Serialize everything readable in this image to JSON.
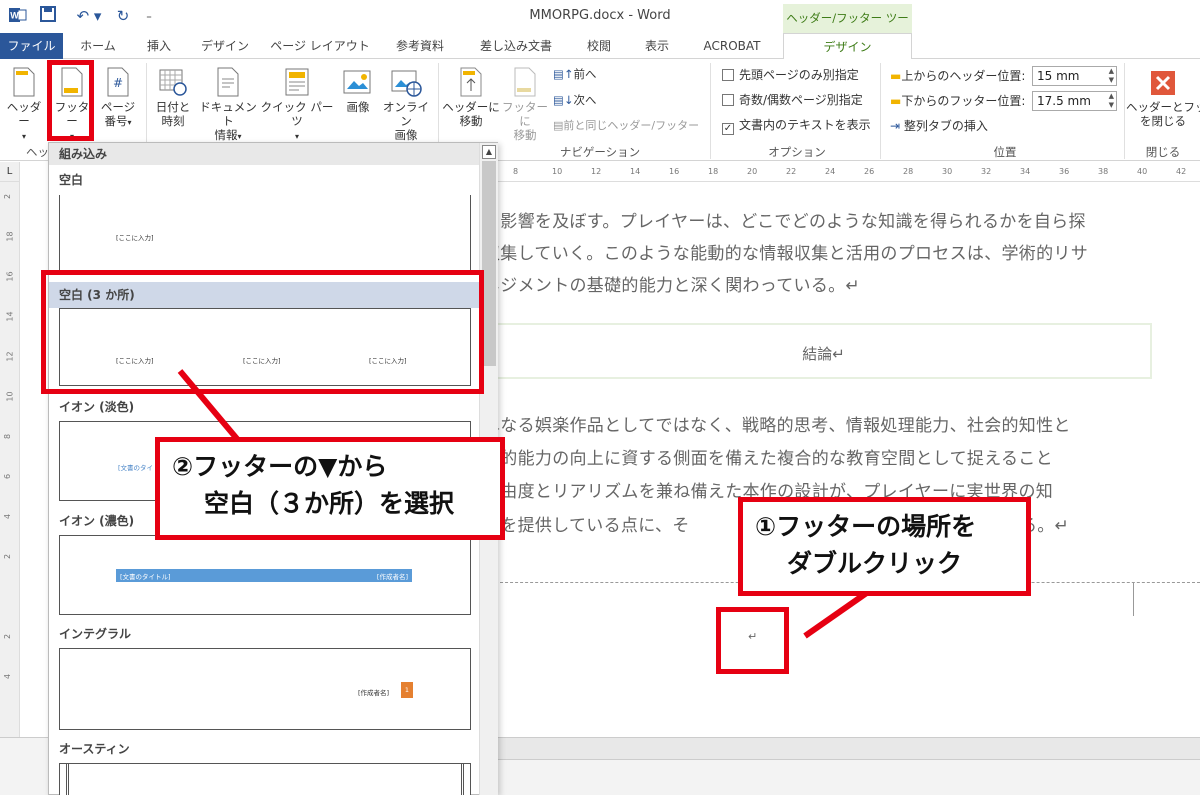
{
  "window": {
    "title": "MMORPG.docx - Word",
    "context_tab": "ヘッダー/フッター ツール"
  },
  "tabs": [
    "ファイル",
    "ホーム",
    "挿入",
    "デザイン",
    "ページ レイアウト",
    "参考資料",
    "差し込み文書",
    "校閲",
    "表示",
    "ACROBAT",
    "デザイン"
  ],
  "ribbon": {
    "header_btn": "ヘッダー",
    "footer_btn": "フッター",
    "pagenum_btn1": "ページ",
    "pagenum_btn2": "番号",
    "date_btn1": "日付と",
    "date_btn2": "時刻",
    "docinfo_btn1": "ドキュメント",
    "docinfo_btn2": "情報",
    "quickparts_btn": "クイック パーツ",
    "picture_btn": "画像",
    "online_btn1": "オンライン",
    "online_btn2": "画像",
    "goto_header1": "ヘッダーに",
    "goto_header2": "移動",
    "goto_footer1": "フッターに",
    "goto_footer2": "移動",
    "prev": "前へ",
    "next": "次へ",
    "link_prev": "前と同じヘッダー/フッター",
    "nav_group": "ナビゲーション",
    "opt_first": "先頭ページのみ別指定",
    "opt_oddeven": "奇数/偶数ページ別指定",
    "opt_showtext": "文書内のテキストを表示",
    "options_group": "オプション",
    "header_pos_label": "上からのヘッダー位置:",
    "header_pos_value": "15 mm",
    "footer_pos_label": "下からのフッター位置:",
    "footer_pos_value": "17.5 mm",
    "align_tab": "整列タブの挿入",
    "position_group": "位置",
    "close_btn1": "ヘッダーとフッ",
    "close_btn2": "を閉じる",
    "close_group": "閉じる",
    "hf_group": "ヘッ"
  },
  "ruler": {
    "h_ticks": [
      "8",
      "10",
      "12",
      "14",
      "16",
      "18",
      "20",
      "22",
      "24",
      "26",
      "28",
      "30",
      "32",
      "34",
      "36",
      "38",
      "40",
      "42"
    ],
    "v_ticks": [
      "2",
      "18",
      "16",
      "14",
      "12",
      "10",
      "8",
      "6",
      "4",
      "2",
      "",
      "2",
      "4"
    ]
  },
  "doc": {
    "p1": [
      "く影響を及ぼす。プレイヤーは、どこでどのような知識を得られるかを自ら探",
      "収集していく。このような能動的な情報収集と活用のプロセスは、学術的リサ",
      "ネジメントの基礎的能力と深く関わっている。↵"
    ],
    "heading": "結論↵",
    "p2": [
      "単なる娯楽作品としてではなく、戦略的思考、情報処理能力、社会的知性と",
      "知的能力の向上に資する側面を備えた複合的な教育空間として捉えること",
      "自由度とリアリズムを兼ね備えた本作の設計が、プレイヤーに実世界の知",
      "戦を提供している点に、そ",
      "る。↵"
    ],
    "footer_mark": "↵"
  },
  "gallery": {
    "section": "組み込み",
    "items": [
      {
        "name": "空白",
        "ph": [
          "[ここに入力]"
        ]
      },
      {
        "name": "空白 (3 か所)",
        "ph": [
          "[ここに入力]",
          "[ここに入力]",
          "[ここに入力]"
        ]
      },
      {
        "name": "イオン (淡色)",
        "ph": [
          "[文書のタイトル]"
        ]
      },
      {
        "name": "イオン (濃色)",
        "ph": [
          "[文書のタイトル]",
          "[作成者名]"
        ]
      },
      {
        "name": "インテグラル",
        "ph": [
          "[作成者名]",
          "1"
        ]
      },
      {
        "name": "オースティン",
        "ph": []
      }
    ]
  },
  "callouts": {
    "c2_line1": "②フッターの▼から",
    "c2_line2": "空白（３か所）を選択",
    "c1_line1": "①フッターの場所を",
    "c1_line2": "ダブルクリック"
  },
  "colors": {
    "accent": "#2b579a",
    "annotation": "#e60012",
    "context": "#3e7c17"
  }
}
